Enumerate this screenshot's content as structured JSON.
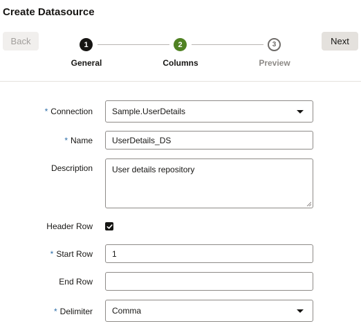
{
  "page": {
    "title": "Create Datasource"
  },
  "nav": {
    "back_label": "Back",
    "next_label": "Next"
  },
  "steps": [
    {
      "number": "1",
      "label": "General",
      "state": "completed"
    },
    {
      "number": "2",
      "label": "Columns",
      "state": "current"
    },
    {
      "number": "3",
      "label": "Preview",
      "state": "upcoming"
    }
  ],
  "form": {
    "required_marker": "*",
    "connection": {
      "label": "Connection",
      "value": "Sample.UserDetails"
    },
    "name": {
      "label": "Name",
      "value": "UserDetails_DS"
    },
    "description": {
      "label": "Description",
      "value": "User details repository"
    },
    "header_row": {
      "label": "Header Row",
      "checked": true
    },
    "start_row": {
      "label": "Start Row",
      "value": "1"
    },
    "end_row": {
      "label": "End Row",
      "value": ""
    },
    "delimiter": {
      "label": "Delimiter",
      "value": "Comma"
    }
  },
  "colors": {
    "step_completed": "#161513",
    "step_current": "#508223",
    "required_marker": "#2d6ea8"
  }
}
